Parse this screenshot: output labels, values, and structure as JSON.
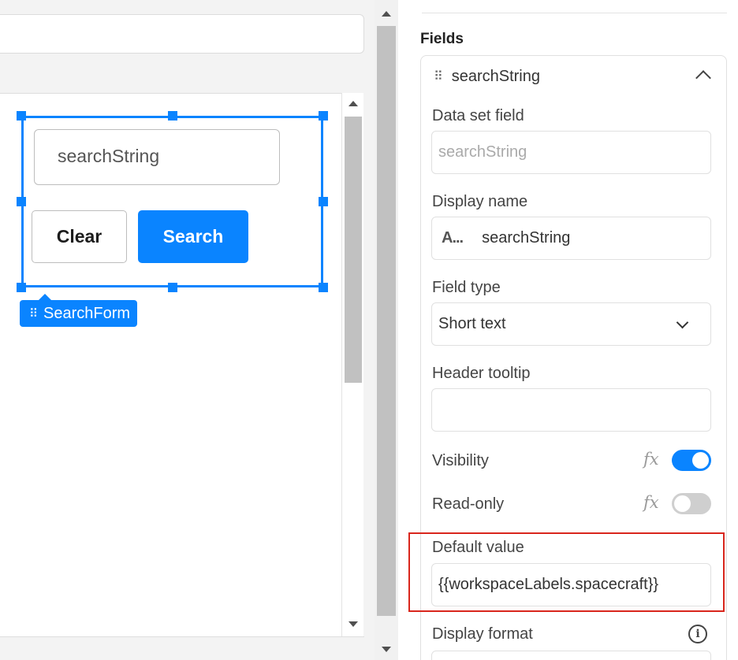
{
  "canvas": {
    "form_input_value": "searchString",
    "clear_label": "Clear",
    "search_label": "Search",
    "component_tag": "SearchForm"
  },
  "panel": {
    "title": "Fields",
    "field": {
      "name": "searchString",
      "data_set_field_label": "Data set field",
      "data_set_field_value": "searchString",
      "display_name_label": "Display name",
      "display_name_icon": "A...",
      "display_name_value": "searchString",
      "field_type_label": "Field type",
      "field_type_value": "Short text",
      "header_tooltip_label": "Header tooltip",
      "header_tooltip_value": "",
      "visibility_label": "Visibility",
      "visibility_on": true,
      "read_only_label": "Read-only",
      "read_only_on": false,
      "fx_symbol": "fx",
      "default_value_label": "Default value",
      "default_value": "{{workspaceLabels.spacecraft}}",
      "display_format_label": "Display format"
    }
  },
  "colors": {
    "accent": "#0a84ff",
    "highlight": "#d9261c"
  }
}
